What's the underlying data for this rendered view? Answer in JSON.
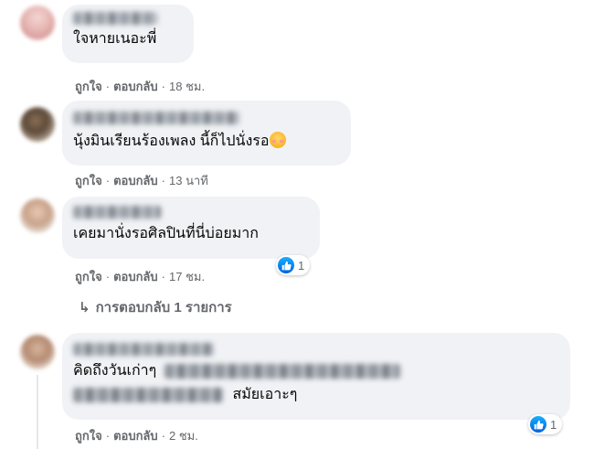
{
  "comments": [
    {
      "text": "ใจหายเนอะพี่",
      "like_label": "ถูกใจ",
      "reply_label": "ตอบกลับ",
      "time": "18 ชม."
    },
    {
      "text": "นุ้งมินเรียนร้องเพลง นี้ก็ไปนั่งรอ",
      "emoji": "smiling-face-with-hearts",
      "like_label": "ถูกใจ",
      "reply_label": "ตอบกลับ",
      "time": "13 นาที"
    },
    {
      "text": "เคยมานั่งรอศิลปินที่นี่บ่อยมาก",
      "like_label": "ถูกใจ",
      "reply_label": "ตอบกลับ",
      "time": "17 ชม.",
      "reaction_count": "1",
      "replies_link": "การตอบกลับ 1 รายการ"
    },
    {
      "text_line1": "คิดถึงวันเก่าๆ",
      "text_line2": "สมัยเอาะๆ",
      "like_label": "ถูกใจ",
      "reply_label": "ตอบกลับ",
      "time": "2 ชม.",
      "reaction_count": "1"
    }
  ],
  "separator": "·",
  "reply_arrow": "↳",
  "colors": {
    "bubble": "#f0f2f5",
    "meta_text": "#65676b",
    "like_blue": "#1877f2"
  },
  "icons": {
    "reaction": "like-icon",
    "reply_arrow": "reply-arrow-icon"
  }
}
